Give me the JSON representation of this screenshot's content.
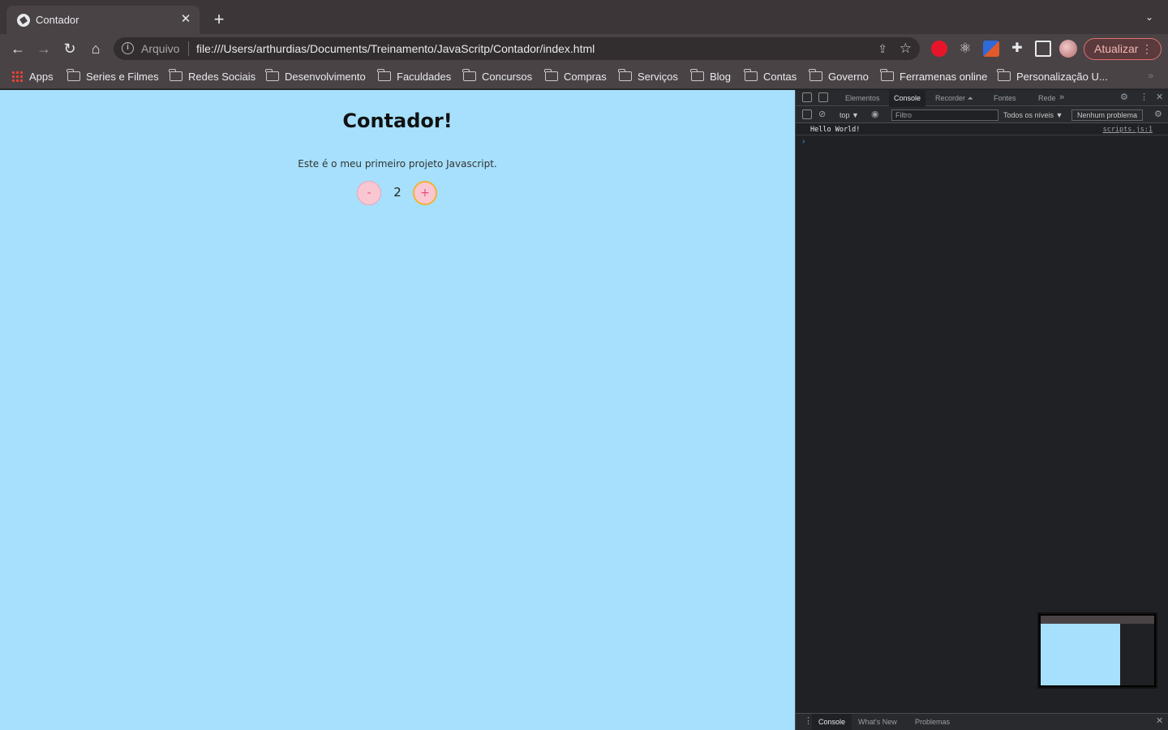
{
  "browser": {
    "tab": {
      "title": "Contador"
    },
    "omnibox": {
      "scheme_label": "Arquivo",
      "url": "file:///Users/arthurdias/Documents/Treinamento/JavaScritp/Contador/index.html"
    },
    "update_button": "Atualizar",
    "bookmarks": [
      "Apps",
      "Series e Filmes",
      "Redes Sociais",
      "Desenvolvimento",
      "Faculdades",
      "Concursos",
      "Compras",
      "Serviços",
      "Blog",
      "Contas",
      "Governo",
      "Ferramenas online",
      "Personalização U..."
    ]
  },
  "page": {
    "heading": "Contador!",
    "description": "Este é o meu primeiro projeto Javascript.",
    "minus_label": "-",
    "plus_label": "+",
    "count": "2"
  },
  "devtools": {
    "tabs": [
      "Elementos",
      "Console",
      "Recorder ⏶",
      "Fontes",
      "Rede"
    ],
    "active_tab": "Console",
    "context": "top ▼",
    "filter_placeholder": "Filtro",
    "levels": "Todos os níveis ▼",
    "issues": "Nenhum problema",
    "console": [
      {
        "message": "Hello World!",
        "source": "scripts.js:1"
      }
    ],
    "drawer_tabs": [
      "Console",
      "What's New",
      "Problemas"
    ]
  }
}
